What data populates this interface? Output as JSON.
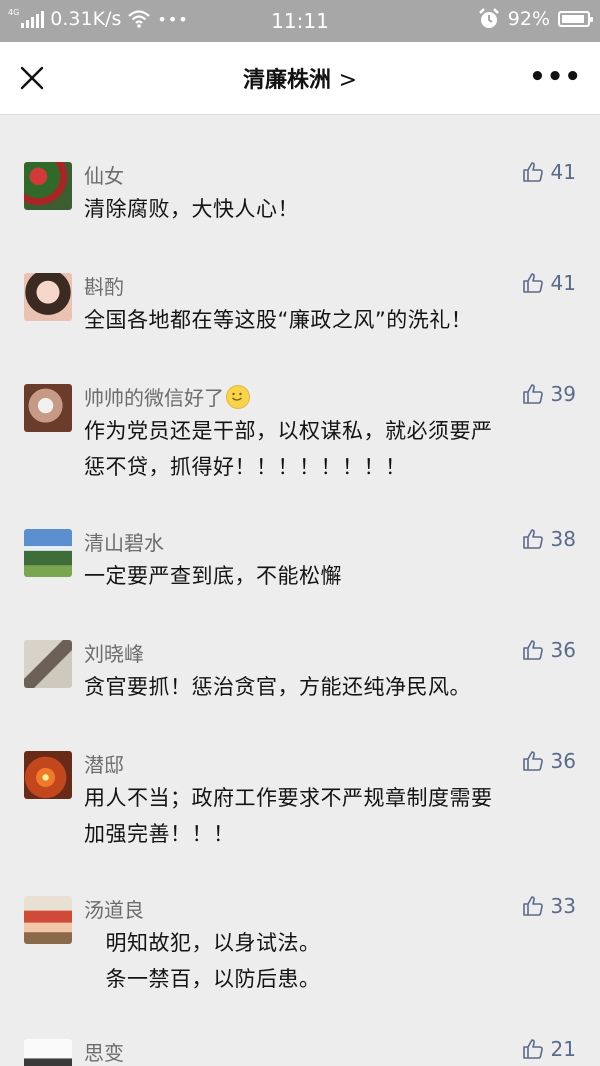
{
  "status_bar": {
    "network_tag": "4G",
    "speed": "0.31K/s",
    "more": "•••",
    "time": "11:11",
    "battery": "92%",
    "battery_level": 0.92
  },
  "nav": {
    "title": "清廉株洲",
    "title_chevron": ">",
    "more": "•••"
  },
  "comments": [
    {
      "name": "仙女",
      "likes": "41",
      "lines": [
        "清除腐败，大快人心！"
      ]
    },
    {
      "name": "斟酌",
      "likes": "41",
      "lines": [
        "全国各地都在等这股“廉政之风”的洗礼！"
      ]
    },
    {
      "name": "帅帅的微信好了",
      "likes": "39",
      "lines": [
        "作为党员还是干部，以权谋私，就必须要严",
        "惩不贷，抓得好！！！！！！！！"
      ]
    },
    {
      "name": "清山碧水",
      "likes": "38",
      "lines": [
        "一定要严查到底，不能松懈"
      ]
    },
    {
      "name": "刘晓峰",
      "likes": "36",
      "lines": [
        "贪官要抓！惩治贪官，方能还纯净民风。"
      ]
    },
    {
      "name": "潜邸",
      "likes": "36",
      "lines": [
        "用人不当；政府工作要求不严规章制度需要",
        "加强完善！！！"
      ]
    },
    {
      "name": "汤道良",
      "likes": "33",
      "lines": [
        "   明知故犯，以身试法。",
        "   条一禁百，以防后患。"
      ]
    },
    {
      "name": "思变",
      "likes": "21",
      "lines": []
    }
  ],
  "icons": {
    "close": "close-icon",
    "more": "more-icon",
    "like": "thumbs-up-icon",
    "emoji": "smile-emoji-icon"
  },
  "colors": {
    "status_bar_bg": "#a7a7a7",
    "page_bg": "#ededed",
    "like_color": "#5a6b8a",
    "name_color": "#6d6d6d"
  }
}
